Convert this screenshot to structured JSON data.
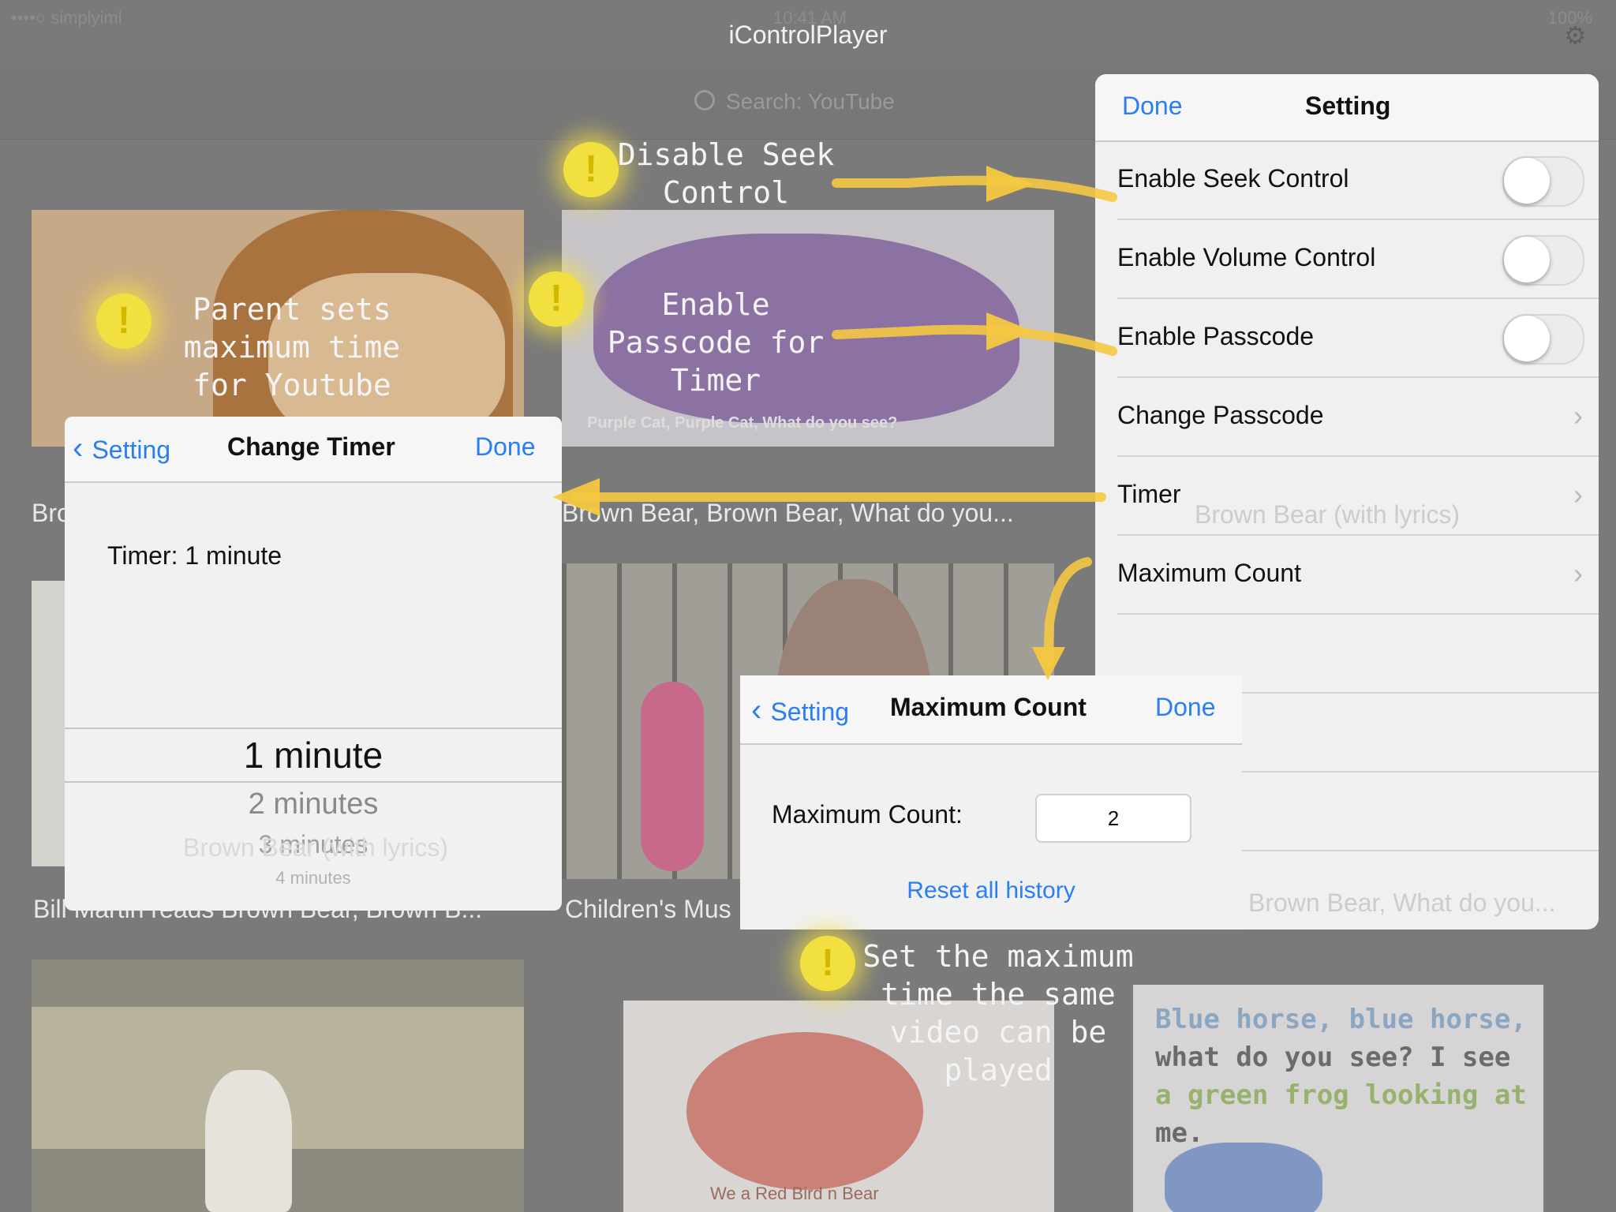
{
  "status": {
    "carrier": "••••○ simplyiml",
    "time": "10:41 AM",
    "battery": "100%"
  },
  "nav": {
    "title": "iControlPlayer"
  },
  "search": {
    "placeholder": "Search: YouTube"
  },
  "videos": [
    {
      "caption": "Bro"
    },
    {
      "caption": "Brown Bear, Brown Bear, What do you...",
      "inner_caption": "Purple Cat, Purple Cat, What do you see?"
    },
    {
      "caption": "Bill Martin reads Brown Bear, Brown B..."
    },
    {
      "caption": "Children's Mus"
    },
    {
      "caption": ""
    },
    {
      "caption": "",
      "inner_caption": "We a Red Bird n Bear"
    },
    {
      "caption": "",
      "poem": [
        "Blue horse, blue horse,",
        "what do you see? I see",
        "a green frog looking at",
        "me."
      ]
    }
  ],
  "annotations": {
    "seek": "Disable Seek Control",
    "timer_parent": "Parent sets maximum time for Youtube",
    "passcode": "Enable Passcode for Timer",
    "max_count": "Set the maximum time the same video can be played"
  },
  "settings": {
    "done": "Done",
    "title": "Setting",
    "rows": [
      {
        "label": "Enable Seek Control",
        "toggle": false
      },
      {
        "label": "Enable Volume Control",
        "toggle": false
      },
      {
        "label": "Enable Passcode",
        "toggle": false
      },
      {
        "label": "Change Passcode"
      },
      {
        "label": "Timer"
      },
      {
        "label": "Maximum Count"
      }
    ],
    "bg_text_1": "Brown Bear (with lyrics)",
    "bg_text_2": "Brown Bear, What do you..."
  },
  "timer": {
    "back": "Setting",
    "title": "Change Timer",
    "done": "Done",
    "value_label": "Timer: 1 minute",
    "options": [
      "1 minute",
      "2 minutes",
      "3 minutes",
      "4 minutes"
    ],
    "bg_text": "Brown Bear (with lyrics)"
  },
  "max_count": {
    "back": "Setting",
    "title": "Maximum Count",
    "done": "Done",
    "label": "Maximum Count:",
    "value": "2",
    "reset": "Reset all history"
  },
  "colors": {
    "accent": "#2a7ef3",
    "annotation": "#f2e040",
    "dim_background": "#7a7a7a"
  }
}
